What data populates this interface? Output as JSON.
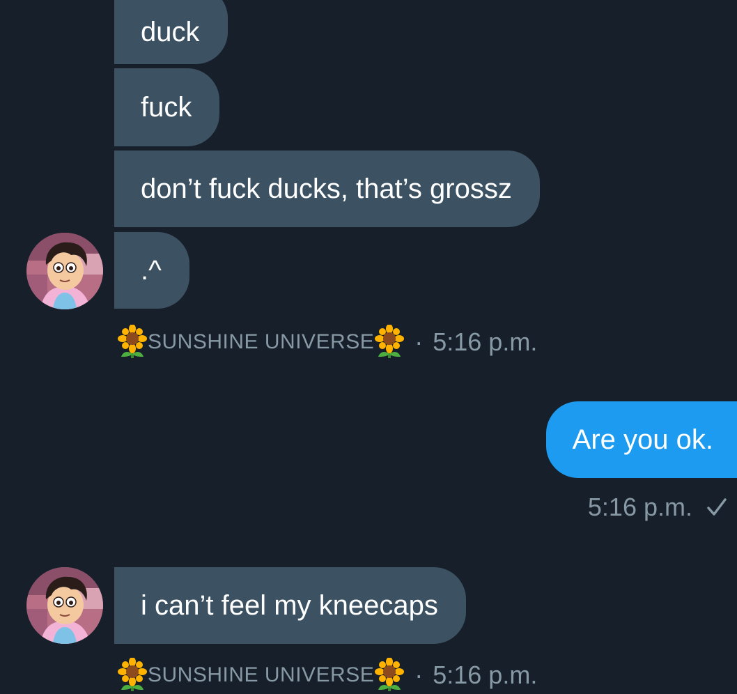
{
  "messages": [
    {
      "text": "duck"
    },
    {
      "text": "fuck"
    },
    {
      "text": "don’t fuck ducks, that’s grossz"
    },
    {
      "text": ".^"
    },
    {
      "text": "Are you ok."
    },
    {
      "text": "i can’t feel my kneecaps"
    }
  ],
  "meta1": {
    "sender": "SUNSHINE UNIVERSE",
    "separator": "·",
    "time": "5:16 p.m."
  },
  "meta2": {
    "time": "5:16 p.m.",
    "status_icon": "check-icon"
  },
  "meta3": {
    "sender": "SUNSHINE UNIVERSE",
    "separator": "·",
    "time": "5:16 p.m."
  },
  "icons": {
    "sender_emoji": "sunflower-icon",
    "avatar": "avatar"
  },
  "colors": {
    "background": "#17202a",
    "incoming_bubble": "#3c5263",
    "outgoing_bubble": "#1d9bf0",
    "meta_text": "#8899a6"
  }
}
